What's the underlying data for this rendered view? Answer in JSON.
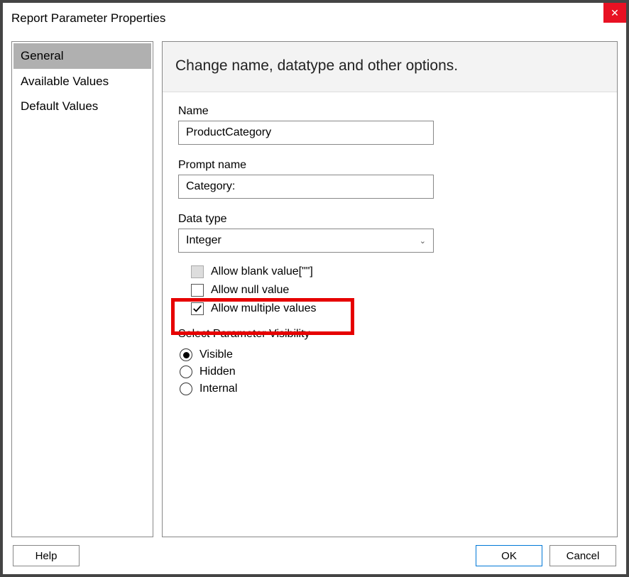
{
  "window": {
    "title": "Report Parameter Properties"
  },
  "sidebar": {
    "items": [
      {
        "label": "General",
        "selected": true
      },
      {
        "label": "Available Values",
        "selected": false
      },
      {
        "label": "Default Values",
        "selected": false
      }
    ]
  },
  "panel": {
    "header": "Change name, datatype and other options.",
    "name_label": "Name",
    "name_value": "ProductCategory",
    "prompt_label": "Prompt name",
    "prompt_value": "Category:",
    "datatype_label": "Data type",
    "datatype_value": "Integer",
    "checkboxes": {
      "blank": {
        "label": "Allow blank value[\"\"]",
        "checked": false,
        "disabled": true
      },
      "null": {
        "label": "Allow null value",
        "checked": false,
        "disabled": false
      },
      "multiple": {
        "label": "Allow multiple values",
        "checked": true,
        "disabled": false
      }
    },
    "visibility_label": "Select Parameter Visibility",
    "visibility_options": [
      {
        "label": "Visible",
        "selected": true
      },
      {
        "label": "Hidden",
        "selected": false
      },
      {
        "label": "Internal",
        "selected": false
      }
    ]
  },
  "footer": {
    "help": "Help",
    "ok": "OK",
    "cancel": "Cancel"
  }
}
